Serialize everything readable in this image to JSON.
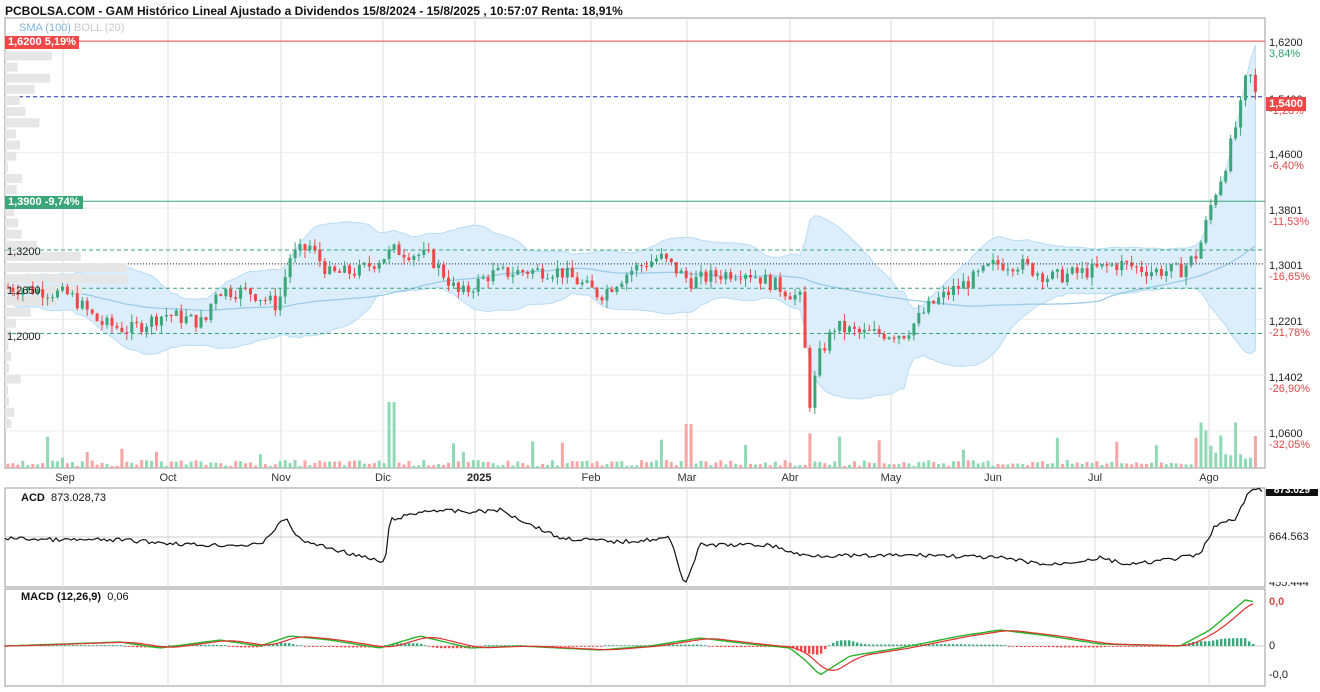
{
  "header": {
    "title": "PCBOLSA.COM - GAM Histórico Lineal Ajustado a Dividendos 15/8/2024 - 15/8/2025 , 10:57:07 Renta: 18,91%",
    "sma_label": "SMA (100)",
    "boll_label": "BOLL (20)"
  },
  "tags": {
    "resistance": "1,6200  5,19%",
    "support": "1,3900  -9,74%",
    "last_price": "1,5400"
  },
  "levels": {
    "l1": "1,3200",
    "l2": "1,2650",
    "l3": "1,2000"
  },
  "price_axis": [
    {
      "price": "1,6200",
      "pct": "3,84%",
      "sign": "pos"
    },
    {
      "price": "1,5400",
      "pct": "-1,28%",
      "sign": "neg"
    },
    {
      "price": "1,4600",
      "pct": "-6,40%",
      "sign": "neg"
    },
    {
      "price": "1,3801",
      "pct": "-11,53%",
      "sign": "neg"
    },
    {
      "price": "1,3001",
      "pct": "-16,65%",
      "sign": "neg"
    },
    {
      "price": "1,2201",
      "pct": "-21,78%",
      "sign": "neg"
    },
    {
      "price": "1,1402",
      "pct": "-26,90%",
      "sign": "neg"
    },
    {
      "price": "1,0600",
      "pct": "-32,05%",
      "sign": "neg"
    }
  ],
  "months": [
    "Sep",
    "Oct",
    "Nov",
    "Dic",
    "2025",
    "Feb",
    "Mar",
    "Abr",
    "May",
    "Jun",
    "Jul",
    "Ago"
  ],
  "acd": {
    "label": "ACD",
    "value": "873.028,73",
    "axis_mid": "664.563",
    "axis_low": "455.444",
    "axis_top": "873.029"
  },
  "macd": {
    "label": "MACD (12,26,9)",
    "value": "0,06",
    "axis_top": "0,0",
    "axis_mid": "0",
    "axis_low": "-0,0"
  },
  "colors": {
    "up": "#3aa67a",
    "down": "#f04848",
    "band": "#dcedfb",
    "sma": "#9ccbe8",
    "grid": "#dddddd"
  },
  "chart_data": {
    "type": "candlestick",
    "title": "GAM Histórico Lineal Ajustado a Dividendos 15/8/2024 - 15/8/2025",
    "ylim": [
      1.06,
      1.62
    ],
    "hlines": [
      1.62,
      1.54,
      1.39,
      1.32,
      1.265,
      1.2
    ],
    "monthly_closes": [
      {
        "month": "Sep",
        "close": 1.21
      },
      {
        "month": "Oct",
        "close": 1.26
      },
      {
        "month": "Nov",
        "close": 1.29
      },
      {
        "month": "Dic",
        "close": 1.31
      },
      {
        "month": "2025",
        "close": 1.29
      },
      {
        "month": "Feb",
        "close": 1.27
      },
      {
        "month": "Mar",
        "close": 1.29
      },
      {
        "month": "Abr",
        "close": 1.19
      },
      {
        "month": "May",
        "close": 1.24
      },
      {
        "month": "Jun",
        "close": 1.29
      },
      {
        "month": "Jul",
        "close": 1.3
      },
      {
        "month": "Ago",
        "close": 1.54
      }
    ]
  }
}
